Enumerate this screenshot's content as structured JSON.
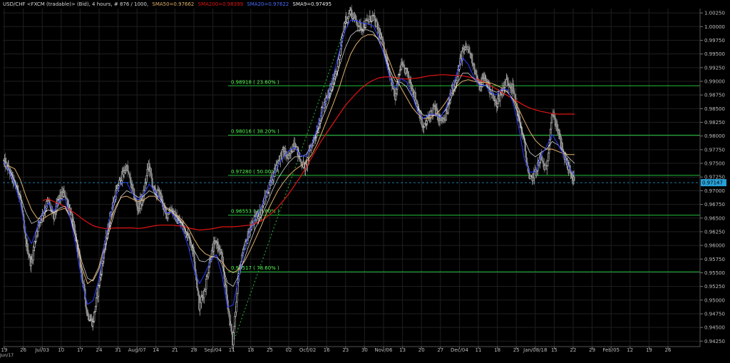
{
  "header": {
    "symbol": "USD/CHF <FXCM (tradable)> (Bid), 4 hours, # 876 / 1000,",
    "sma50_label": "SMA50=0.97662",
    "sma200_label": "SMA200=0.98399",
    "sma20_label": "SMA20=0.97622",
    "sma9_label": "SMA9=0.97495"
  },
  "colors": {
    "background": "#000000",
    "grid": "#1f1f1f",
    "candle_up": "#e8e8e8",
    "candle_down": "#8a8a8a",
    "sma9": "#2a3cff",
    "sma20": "#e8e8e8",
    "sma50": "#e2b06a",
    "sma200": "#e11414",
    "fib": "#22c03a",
    "fib_text": "#55ff55",
    "price_tag_bg": "#28a0d8",
    "axis_text": "#bdbdbd"
  },
  "chart_data": {
    "type": "candlestick",
    "title": "USD/CHF <FXCM (tradable)> (Bid), 4 hours, # 876 / 1000,",
    "x_tick_labels": [
      "19",
      "26",
      "Jul/03",
      "10",
      "17",
      "24",
      "31",
      "Aug/07",
      "14",
      "21",
      "28",
      "Sep/04",
      "11",
      "18",
      "25",
      "02",
      "Oct/02",
      "16",
      "23",
      "30",
      "Nov/06",
      "13",
      "20",
      "27",
      "Dec/04",
      "11",
      "18",
      "25",
      "Jan/08/18",
      "15",
      "22",
      "29",
      "Feb/05",
      "12",
      "19",
      "26"
    ],
    "x_start_label": "Jun/17",
    "y_ticks": [
      1.0025,
      1.0,
      0.9975,
      0.995,
      0.9925,
      0.99,
      0.9875,
      0.985,
      0.9825,
      0.98,
      0.9775,
      0.975,
      0.9725,
      0.97,
      0.9675,
      0.965,
      0.9625,
      0.96,
      0.9575,
      0.955,
      0.9525,
      0.95,
      0.9475,
      0.945,
      0.9425
    ],
    "ylim": [
      0.9415,
      1.0033
    ],
    "last_price": 0.97147,
    "last_price_label": "0.97147",
    "fib_levels": [
      {
        "value": 0.98918,
        "label": "0.98918 ( 23.60% )"
      },
      {
        "value": 0.98016,
        "label": "0.98016 ( 38.20% )"
      },
      {
        "value": 0.9728,
        "label": "0.97280 ( 50.00% )"
      },
      {
        "value": 0.96553,
        "label": "0.96553 ( 61.80% )"
      },
      {
        "value": 0.95517,
        "label": "0.95517 ( 78.60% )"
      }
    ],
    "swing_low": 0.9422,
    "swing_high": 1.0028,
    "price_path": [
      0.9755,
      0.9738,
      0.9712,
      0.9692,
      0.9608,
      0.9565,
      0.9628,
      0.9655,
      0.9682,
      0.965,
      0.9688,
      0.9695,
      0.9662,
      0.9612,
      0.9551,
      0.9475,
      0.9458,
      0.9522,
      0.9588,
      0.9648,
      0.9692,
      0.9722,
      0.9745,
      0.9705,
      0.9668,
      0.9688,
      0.9748,
      0.9695,
      0.9695,
      0.9655,
      0.9668,
      0.9648,
      0.9638,
      0.9618,
      0.9588,
      0.949,
      0.952,
      0.9578,
      0.9608,
      0.9582,
      0.95,
      0.9422,
      0.9548,
      0.9592,
      0.9628,
      0.9648,
      0.9662,
      0.9692,
      0.9722,
      0.9752,
      0.9772,
      0.9758,
      0.9792,
      0.9755,
      0.9742,
      0.9782,
      0.9808,
      0.985,
      0.9872,
      0.9902,
      0.994,
      1.0008,
      1.0028,
      1.001,
      0.9998,
      1.0008,
      1.0018,
      0.9995,
      0.996,
      0.9918,
      0.9868,
      0.9928,
      0.9918,
      0.989,
      0.9858,
      0.9812,
      0.9835,
      0.9852,
      0.9828,
      0.983,
      0.9878,
      0.9908,
      0.9952,
      0.9962,
      0.9932,
      0.9888,
      0.9908,
      0.9882,
      0.9858,
      0.988,
      0.9902,
      0.9888,
      0.9838,
      0.979,
      0.9718,
      0.9732,
      0.9762,
      0.9735,
      0.9842,
      0.9815,
      0.9768,
      0.9742,
      0.9715
    ],
    "sma9_path": [
      0.9752,
      0.9736,
      0.9712,
      0.9676,
      0.9623,
      0.9603,
      0.9633,
      0.9658,
      0.9678,
      0.9662,
      0.9683,
      0.9684,
      0.9646,
      0.9595,
      0.9532,
      0.9492,
      0.9499,
      0.9537,
      0.96,
      0.9652,
      0.9688,
      0.9715,
      0.9715,
      0.9695,
      0.9683,
      0.9693,
      0.9712,
      0.97,
      0.9683,
      0.966,
      0.966,
      0.9646,
      0.9628,
      0.9598,
      0.9556,
      0.953,
      0.9549,
      0.9573,
      0.9583,
      0.9546,
      0.9487,
      0.9491,
      0.9541,
      0.959,
      0.9627,
      0.965,
      0.9669,
      0.9695,
      0.9723,
      0.9747,
      0.9761,
      0.9774,
      0.9779,
      0.9765,
      0.9762,
      0.9782,
      0.9815,
      0.9849,
      0.9874,
      0.9914,
      0.9955,
      0.9993,
      1.0012,
      1.0011,
      1.0007,
      1.0005,
      1.0002,
      0.9981,
      0.9947,
      0.9905,
      0.9887,
      0.9905,
      0.9899,
      0.9874,
      0.9843,
      0.9832,
      0.984,
      0.984,
      0.9834,
      0.9851,
      0.9882,
      0.9916,
      0.9943,
      0.9931,
      0.9908,
      0.9893,
      0.9893,
      0.988,
      0.9875,
      0.9886,
      0.9885,
      0.9861,
      0.9817,
      0.9759,
      0.9734,
      0.9734,
      0.9764,
      0.9781,
      0.9803,
      0.9786,
      0.9765,
      0.9743,
      0.9728
    ],
    "sma20_path": [
      0.975,
      0.9738,
      0.9718,
      0.969,
      0.966,
      0.964,
      0.9645,
      0.9658,
      0.9665,
      0.966,
      0.9668,
      0.9672,
      0.9648,
      0.961,
      0.957,
      0.954,
      0.9535,
      0.9555,
      0.959,
      0.963,
      0.9665,
      0.969,
      0.97,
      0.9695,
      0.9688,
      0.969,
      0.97,
      0.9695,
      0.9685,
      0.967,
      0.9663,
      0.9652,
      0.9638,
      0.9618,
      0.9592,
      0.9572,
      0.957,
      0.9578,
      0.9582,
      0.9565,
      0.9532,
      0.9525,
      0.9545,
      0.9575,
      0.9605,
      0.9632,
      0.9652,
      0.9675,
      0.97,
      0.9722,
      0.9738,
      0.9752,
      0.9762,
      0.9762,
      0.9766,
      0.9781,
      0.9806,
      0.9834,
      0.986,
      0.9893,
      0.9928,
      0.996,
      0.9983,
      0.9992,
      0.9994,
      0.9994,
      0.999,
      0.9975,
      0.995,
      0.992,
      0.99,
      0.9898,
      0.989,
      0.9872,
      0.985,
      0.9838,
      0.9838,
      0.9838,
      0.9836,
      0.9848,
      0.987,
      0.9895,
      0.9915,
      0.9915,
      0.9905,
      0.9895,
      0.9893,
      0.9885,
      0.988,
      0.9884,
      0.9882,
      0.9866,
      0.9836,
      0.9795,
      0.977,
      0.9762,
      0.977,
      0.9776,
      0.979,
      0.9784,
      0.9772,
      0.976,
      0.975
    ],
    "sma50_path": [
      0.9745,
      0.9745,
      0.974,
      0.972,
      0.969,
      0.9665,
      0.965,
      0.9648,
      0.9655,
      0.966,
      0.9665,
      0.9668,
      0.965,
      0.961,
      0.956,
      0.953,
      0.9538,
      0.956,
      0.96,
      0.964,
      0.967,
      0.9688,
      0.969,
      0.9685,
      0.968,
      0.9683,
      0.969,
      0.969,
      0.968,
      0.9668,
      0.966,
      0.9655,
      0.9645,
      0.9632,
      0.9612,
      0.9595,
      0.9585,
      0.958,
      0.9578,
      0.957,
      0.9556,
      0.955,
      0.9556,
      0.957,
      0.959,
      0.9612,
      0.9635,
      0.966,
      0.968,
      0.97,
      0.9715,
      0.9728,
      0.9738,
      0.9745,
      0.9752,
      0.9765,
      0.9785,
      0.981,
      0.9836,
      0.9862,
      0.989,
      0.9922,
      0.995,
      0.9968,
      0.998,
      0.9985,
      0.9985,
      0.9978,
      0.9962,
      0.9935,
      0.9908,
      0.9888,
      0.987,
      0.9852,
      0.984,
      0.9832,
      0.9832,
      0.9838,
      0.9848,
      0.9862,
      0.9878,
      0.9892,
      0.99,
      0.9903,
      0.99,
      0.9898,
      0.9898,
      0.9897,
      0.9893,
      0.9888,
      0.988,
      0.9868,
      0.985,
      0.9828,
      0.9808,
      0.9792,
      0.9782,
      0.9776,
      0.9776,
      0.9772,
      0.9768,
      0.9766,
      0.9766
    ],
    "sma200_path": [
      null,
      null,
      null,
      null,
      null,
      null,
      null,
      0.9682,
      0.9685,
      0.968,
      0.9676,
      0.967,
      0.9664,
      0.9657,
      0.9649,
      0.9642,
      0.9636,
      0.9633,
      0.9631,
      0.9631,
      0.9632,
      0.9632,
      0.9632,
      0.9632,
      0.9631,
      0.9632,
      0.9634,
      0.9636,
      0.9637,
      0.9637,
      0.9637,
      0.9636,
      0.9635,
      0.9632,
      0.963,
      0.9628,
      0.9629,
      0.963,
      0.9632,
      0.9634,
      0.9634,
      0.9634,
      0.9635,
      0.9636,
      0.9637,
      0.964,
      0.9645,
      0.9652,
      0.966,
      0.967,
      0.9682,
      0.9695,
      0.971,
      0.9725,
      0.9742,
      0.976,
      0.9778,
      0.9795,
      0.981,
      0.9825,
      0.984,
      0.9855,
      0.9867,
      0.9878,
      0.9888,
      0.9896,
      0.9902,
      0.9906,
      0.9908,
      0.9908,
      0.9907,
      0.9905,
      0.9904,
      0.9905,
      0.9906,
      0.9908,
      0.991,
      0.9911,
      0.9912,
      0.9912,
      0.9911,
      0.9911,
      0.991,
      0.9908,
      0.9906,
      0.9902,
      0.9898,
      0.9892,
      0.9886,
      0.988,
      0.9874,
      0.9868,
      0.9862,
      0.9856,
      0.9851,
      0.9848,
      0.9845,
      0.9843,
      0.9841,
      0.984,
      0.984,
      0.984,
      0.984
    ],
    "grid": true
  }
}
